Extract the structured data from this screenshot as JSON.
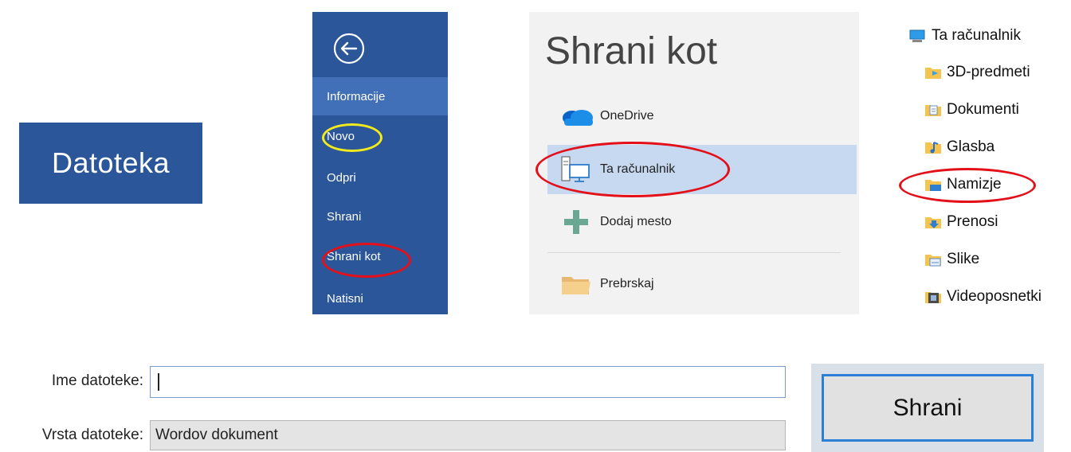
{
  "file_tab": {
    "label": "Datoteka"
  },
  "backstage": {
    "items": [
      {
        "label": "Informacije"
      },
      {
        "label": "Novo"
      },
      {
        "label": "Odpri"
      },
      {
        "label": "Shrani"
      },
      {
        "label": "Shrani kot"
      },
      {
        "label": "Natisni"
      }
    ]
  },
  "save_as": {
    "title": "Shrani kot",
    "locations": [
      {
        "label": "OneDrive",
        "icon": "onedrive-cloud-icon"
      },
      {
        "label": "Ta računalnik",
        "icon": "this-pc-icon"
      },
      {
        "label": "Dodaj mesto",
        "icon": "plus-icon"
      },
      {
        "label": "Prebrskaj",
        "icon": "folder-icon"
      }
    ]
  },
  "folder_tree": {
    "root": "Ta računalnik",
    "items": [
      {
        "label": "3D-predmeti",
        "icon": "3d-objects-folder-icon"
      },
      {
        "label": "Dokumenti",
        "icon": "documents-folder-icon"
      },
      {
        "label": "Glasba",
        "icon": "music-folder-icon"
      },
      {
        "label": "Namizje",
        "icon": "desktop-folder-icon"
      },
      {
        "label": "Prenosi",
        "icon": "downloads-folder-icon"
      },
      {
        "label": "Slike",
        "icon": "pictures-folder-icon"
      },
      {
        "label": "Videoposnetki",
        "icon": "videos-folder-icon"
      }
    ]
  },
  "fields": {
    "name_label": "Ime datoteke:",
    "name_value": "",
    "type_label": "Vrsta datoteke:",
    "type_value": "Wordov dokument"
  },
  "save_button": {
    "label": "Shrani"
  },
  "colors": {
    "word_blue": "#2b579a",
    "selection_blue": "#c6d9f1",
    "highlight_red": "#e3101a",
    "highlight_yellow": "#f2ea1d",
    "focus_blue": "#2b7fd6"
  }
}
